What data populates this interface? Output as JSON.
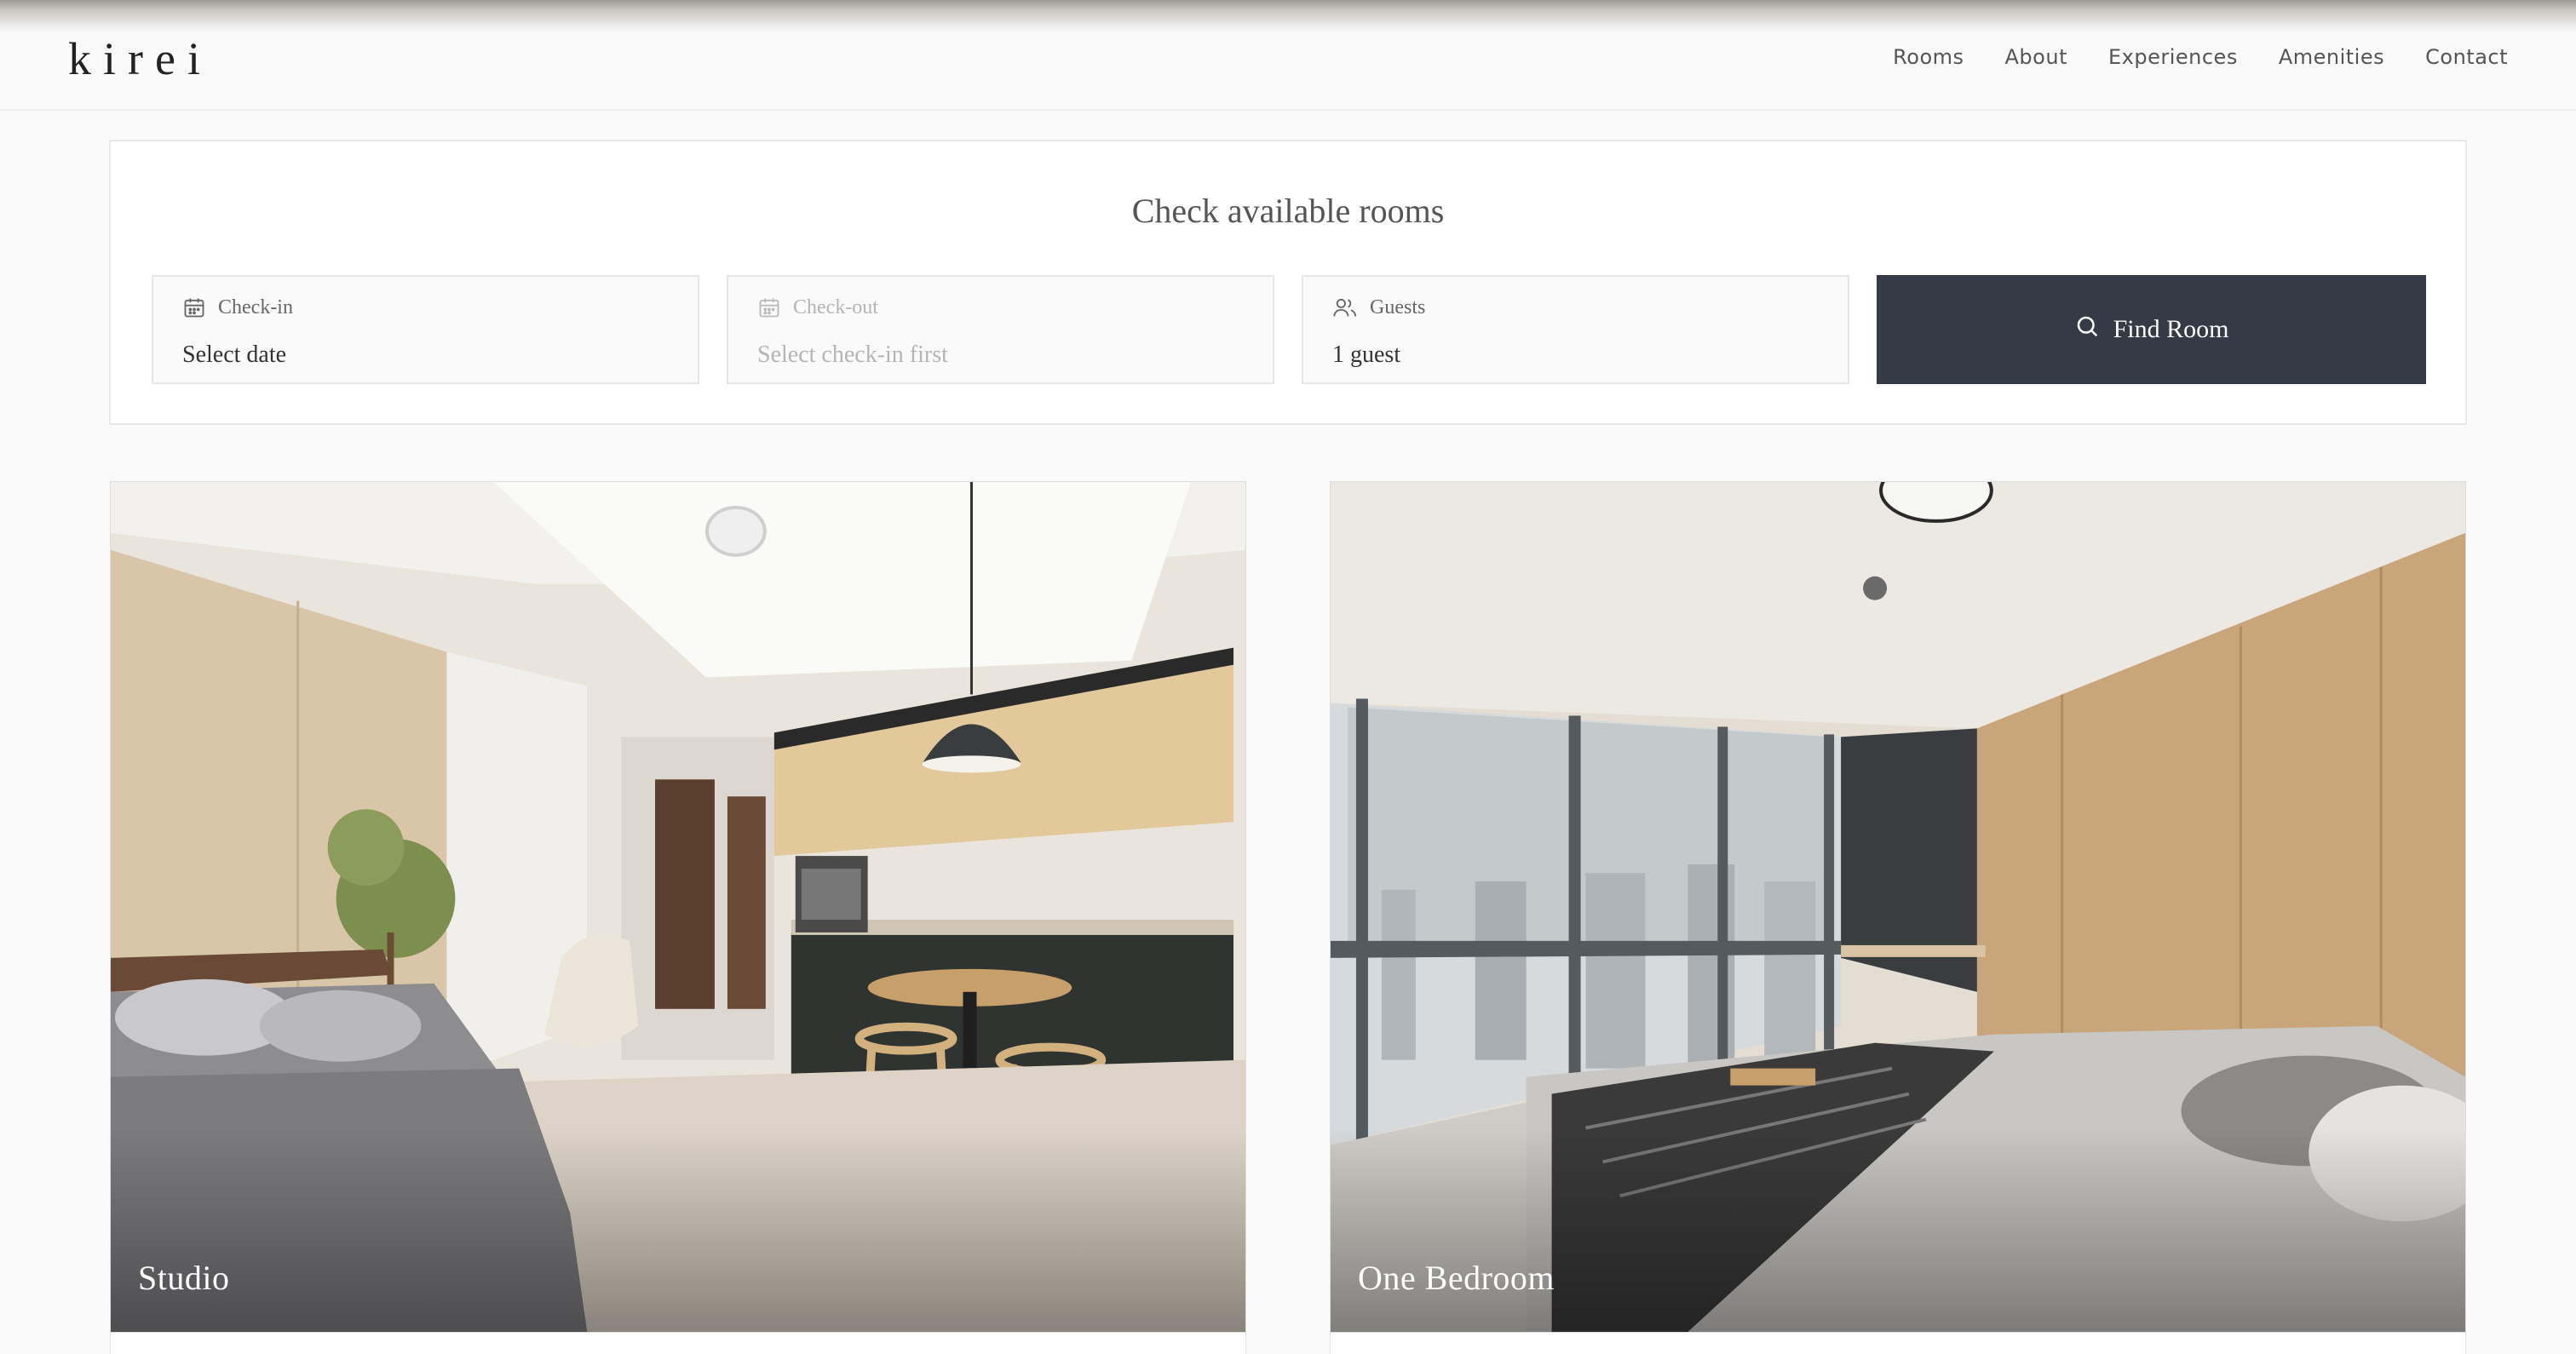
{
  "header": {
    "logo": "kirei",
    "nav": [
      "Rooms",
      "About",
      "Experiences",
      "Amenities",
      "Contact"
    ]
  },
  "booking": {
    "title": "Check available rooms",
    "checkin": {
      "label": "Check-in",
      "value": "Select date",
      "icon": "calendar-icon"
    },
    "checkout": {
      "label": "Check-out",
      "value": "Select check-in first",
      "icon": "calendar-icon",
      "disabled": true
    },
    "guests": {
      "label": "Guests",
      "value": "1 guest",
      "icon": "users-icon"
    },
    "find_button": {
      "label": "Find Room",
      "icon": "search-icon"
    }
  },
  "rooms": [
    {
      "name": "Studio"
    },
    {
      "name": "One Bedroom"
    }
  ],
  "colors": {
    "button_bg": "#353a44",
    "page_bg": "#fafafa",
    "accent_wood": "#d8c3a0"
  }
}
